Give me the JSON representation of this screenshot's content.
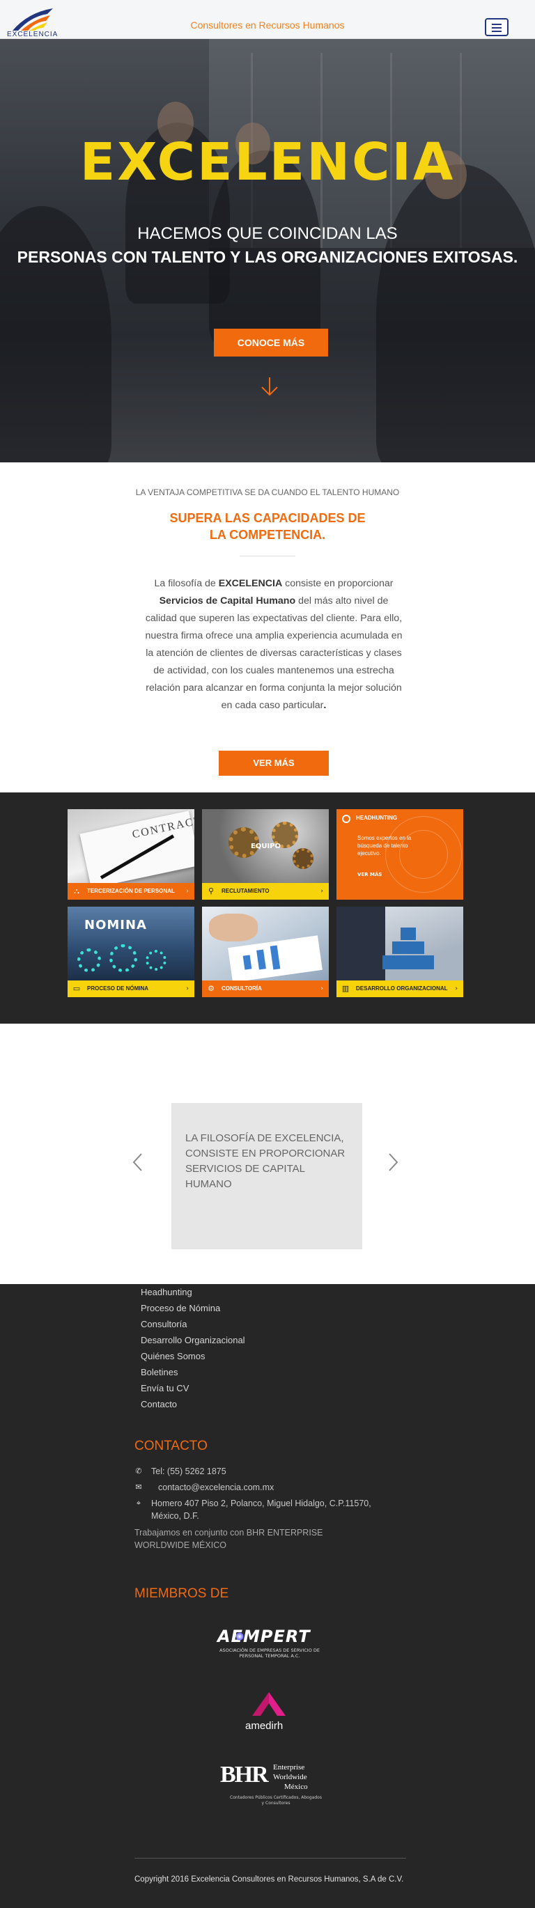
{
  "header": {
    "logo_text": "EXCELENCIA",
    "tagline": "Consultores en Recursos Humanos",
    "menu_icon": "hamburger-menu-icon"
  },
  "hero": {
    "title": "EXCELENCIA",
    "line1": "HACEMOS QUE COINCIDAN LAS",
    "line2": "PERSONAS CON TALENTO Y LAS ORGANIZACIONES EXITOSAS.",
    "button": "CONOCE MÁS",
    "arrow_icon": "arrow-down-icon"
  },
  "philosophy": {
    "subtitle": "LA VENTAJA COMPETITIVA SE DA CUANDO EL TALENTO HUMANO",
    "title": "SUPERA LAS CAPACIDADES DE LA COMPETENCIA.",
    "text_1": "La filosofía de ",
    "text_brand": "EXCELENCIA",
    "text_2": " consiste en proporcionar ",
    "text_service": "Servicios de Capital Humano",
    "text_3": " del más alto nivel de calidad que superen las expectativas del cliente. Para ello, nuestra firma ofrece una amplia experiencia acumulada en la atención de clientes de diversas características y clases de actividad, con los cuales mantenemos una estrecha relación para alcanzar en forma conjunta la mejor solución en cada caso particular",
    "text_end": ".",
    "button": "VER MÁS"
  },
  "services": [
    {
      "label": "TERCERIZACIÓN DE PERSONAL",
      "icon": "org-chart-icon",
      "bar": "orange",
      "image_text": "CONTRACT"
    },
    {
      "label": "RECLUTAMIENTO",
      "icon": "magnifier-icon",
      "bar": "yellow",
      "image_text": "EQUIPO"
    },
    {
      "label": "HEADHUNTING",
      "icon": "target-icon",
      "bar": "orange",
      "hover_text": "Somos expertos en la búsqueda de talento ejecutivo.",
      "hover_link": "VER MÁS"
    },
    {
      "label": "PROCESO DE NÓMINA",
      "icon": "money-icon",
      "bar": "yellow",
      "image_text": "NOMINA"
    },
    {
      "label": "CONSULTORÍA",
      "icon": "gear-icon",
      "bar": "orange"
    },
    {
      "label": "DESARROLLO ORGANIZACIONAL",
      "icon": "chart-icon",
      "bar": "yellow"
    }
  ],
  "carousel": {
    "text": "LA FILOSOFÍA DE EXCELENCIA, CONSISTE EN PROPORCIONAR SERVICIOS DE CAPITAL HUMANO",
    "prev_icon": "chevron-left-icon",
    "next_icon": "chevron-right-icon"
  },
  "footer": {
    "links": [
      "Headhunting",
      "Proceso de Nómina",
      "Consultoría",
      "Desarrollo Organizacional",
      "Quiénes Somos",
      "Boletines",
      "Envía tu CV",
      "Contacto"
    ],
    "contact_heading": "CONTACTO",
    "phone": "Tel: (55) 5262 1875",
    "email": "contacto@excelencia.com.mx",
    "address_1": "Homero 407 Piso 2, Polanco, Miguel Hidalgo, C.P.11570,",
    "address_2": "México, D.F.",
    "partner": "Trabajamos en conjunto con   BHR ENTERPRISE WORLDWIDE MÉXICO",
    "members_heading": "MIEMBROS DE",
    "members": [
      {
        "name": "AEMPERT",
        "subtitle": "ASOCIACIÓN DE EMPRESAS DE SERVICIO DE PERSONAL TEMPORAL A.C."
      },
      {
        "name": "amedirh"
      },
      {
        "name": "BHR",
        "title_1": "Enterprise",
        "title_2": "Worldwide",
        "title_3": "México",
        "subtitle_1": "Contadores Públicos Certificados, Abogados",
        "subtitle_2": "y Consultores"
      }
    ],
    "copyright": "Copyright 2016 Excelencia Consultores en Recursos Humanos, S.A de C.V."
  },
  "colors": {
    "accent": "#f26a0e",
    "yellow": "#f6d30b",
    "dark": "#262626",
    "navy": "#22367f"
  }
}
